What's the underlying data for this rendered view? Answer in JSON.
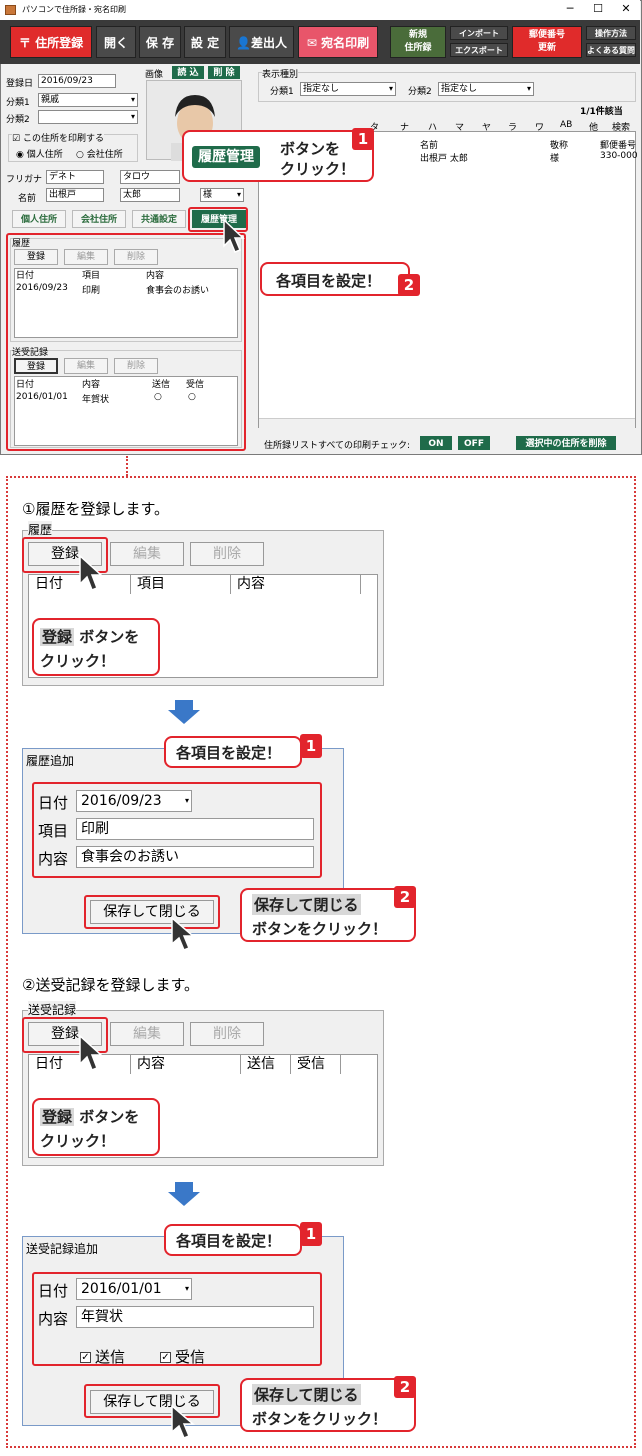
{
  "window": {
    "title": "パソコンで住所録・宛名印刷",
    "controls": [
      "─",
      "☐",
      "✕"
    ]
  },
  "toolbar": {
    "address_reg": "住所登録",
    "open": "開く",
    "save": "保 存",
    "settings": "設 定",
    "sender": "差出人",
    "label_print": "宛名印刷",
    "new_book": "新規\n住所録",
    "import": "インポート",
    "export": "エクスポート",
    "postal_update": "郵便番号\n更新",
    "howto": "操作方法",
    "faq": "よくある質問"
  },
  "left": {
    "reg_date_label": "登録日",
    "reg_date": "2016/09/23",
    "image_label": "画像",
    "read_btn": "読 込",
    "del_btn": "削 除",
    "cat1_label": "分類1",
    "cat1": "親戚",
    "cat2_label": "分類2",
    "cat2": "",
    "print_check": "この住所を印刷する",
    "personal": "個人住所",
    "company": "会社住所",
    "furigana_label": "フリガナ",
    "furigana_last": "デネト",
    "furigana_first": "タロウ",
    "name_label": "名前",
    "name_last": "出根戸",
    "name_first": "太郎",
    "honorific": "様",
    "tabs": [
      "個人住所",
      "会社住所",
      "共通設定",
      "履歴管理"
    ],
    "history": {
      "title": "履歴",
      "buttons": [
        "登録",
        "編集",
        "削除"
      ],
      "cols": [
        "日付",
        "項目",
        "内容"
      ],
      "rows": [
        [
          "2016/09/23",
          "印刷",
          "食事会のお誘い"
        ]
      ]
    },
    "sendrecv": {
      "title": "送受記録",
      "buttons": [
        "登録",
        "編集",
        "削除"
      ],
      "cols": [
        "日付",
        "内容",
        "送信",
        "受信"
      ],
      "rows": [
        [
          "2016/01/01",
          "年賀状",
          "○",
          "○"
        ]
      ]
    }
  },
  "right": {
    "display_type": "表示種別",
    "cat1_label": "分類1",
    "cat1": "指定なし",
    "cat2_label": "分類2",
    "cat2": "指定なし",
    "count": "1/1件該当",
    "index_tabs": [
      "タ",
      "ナ",
      "ハ",
      "マ",
      "ヤ",
      "ラ",
      "ワ",
      "AB",
      "他",
      "検索"
    ],
    "cols": [
      "名前",
      "敬称",
      "郵便番号"
    ],
    "row": [
      "出根戸 太郎",
      "様",
      "330-000"
    ],
    "bottom_label": "住所録リストすべての印刷チェック:",
    "on": "ON",
    "off": "OFF",
    "delete_selected": "選択中の住所を削除"
  },
  "callouts": {
    "c1_btn": "履歴管理",
    "c1_text1": "ボタンを",
    "c1_text2": "クリック！",
    "n1": "1",
    "c2_text": "各項目を設定！",
    "n2": "2"
  },
  "step1": {
    "heading": "①履歴を登録します。",
    "group_title": "履歴",
    "buttons": [
      "登録",
      "編集",
      "削除"
    ],
    "cols": [
      "日付",
      "項目",
      "内容"
    ],
    "callout_btn": "登録",
    "callout_text1": "ボタンを",
    "callout_text2": "クリック！"
  },
  "dialog1": {
    "title": "履歴追加",
    "callout": "各項目を設定！",
    "n1": "1",
    "date_label": "日付",
    "date": "2016/09/23",
    "item_label": "項目",
    "item": "印刷",
    "content_label": "内容",
    "content": "食事会のお誘い",
    "save_btn": "保存して閉じる",
    "callout2_btn": "保存して閉じる",
    "callout2_text": "ボタンをクリック！",
    "n2": "2"
  },
  "step2": {
    "heading": "②送受記録を登録します。",
    "group_title": "送受記録",
    "buttons": [
      "登録",
      "編集",
      "削除"
    ],
    "cols": [
      "日付",
      "内容",
      "送信",
      "受信"
    ],
    "callout_btn": "登録",
    "callout_text1": "ボタンを",
    "callout_text2": "クリック！"
  },
  "dialog2": {
    "title": "送受記録追加",
    "callout": "各項目を設定！",
    "n1": "1",
    "date_label": "日付",
    "date": "2016/01/01",
    "content_label": "内容",
    "content": "年賀状",
    "send_label": "送信",
    "recv_label": "受信",
    "save_btn": "保存して閉じる",
    "callout2_btn": "保存して閉じる",
    "callout2_text": "ボタンをクリック！",
    "n2": "2"
  }
}
